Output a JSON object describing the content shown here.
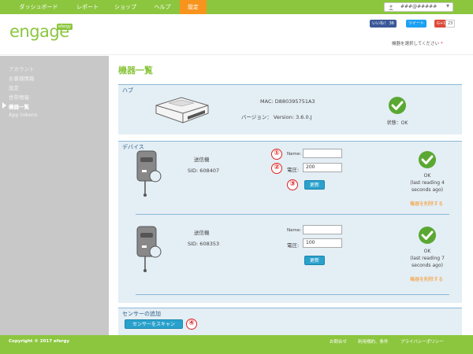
{
  "nav": {
    "items": [
      {
        "label": "ダッシュボード"
      },
      {
        "label": "レポート"
      },
      {
        "label": "ショップ"
      },
      {
        "label": "ヘルプ"
      },
      {
        "label": "設定"
      }
    ],
    "user_name": "###@#####"
  },
  "header": {
    "logo_text": "engage",
    "logo_badge": "efergy",
    "fb_label": "いいね！ 36",
    "tw_label": "ツイート",
    "gp_label": "G+1",
    "social_count": "23",
    "device_select_hint": "機器を選択してください",
    "required_mark": "*"
  },
  "sidebar": {
    "items": [
      {
        "label": "アカウント"
      },
      {
        "label": "お客様情報"
      },
      {
        "label": "設定"
      },
      {
        "label": "世帯情報"
      },
      {
        "label": "機器一覧"
      },
      {
        "label": "App tokens"
      }
    ]
  },
  "main": {
    "page_title": "機器一覧",
    "hub": {
      "title": "ハブ",
      "mac": "MAC: D880395751A3",
      "version": "バージョン： Version: 3.6.0.J",
      "status": "状態：OK"
    },
    "devices_title": "デバイス",
    "devices": [
      {
        "type": "送信機",
        "sid": "SID: 608407",
        "name_label": "Name:",
        "name_value": "",
        "voltage_label": "電圧:",
        "voltage_value": "200",
        "update_label": "更新",
        "status_ok": "OK",
        "status_detail_1": "(last reading 4",
        "status_detail_2": "seconds ago)",
        "remove_label": "機器を削除する"
      },
      {
        "type": "送信機",
        "sid": "SID: 608353",
        "name_label": "Name:",
        "name_value": "",
        "voltage_label": "電圧:",
        "voltage_value": "100",
        "update_label": "更新",
        "status_ok": "OK",
        "status_detail_1": "(last reading 7",
        "status_detail_2": "seconds ago)",
        "remove_label": "機器を削除する"
      }
    ],
    "add_sensor_title": "センサーの追加",
    "scan_button": "センサーをスキャン",
    "markers": [
      "①",
      "②",
      "③",
      "④"
    ]
  },
  "footer": {
    "copyright": "Copyright © 2017 efergy",
    "links": [
      {
        "label": "お問合せ"
      },
      {
        "label": "利用規約、条件"
      },
      {
        "label": "プライバシーポリシー"
      }
    ]
  },
  "colors": {
    "brand_green": "#8cc63f",
    "active_orange": "#f7941d",
    "button_blue": "#2aa1cc",
    "panel_bg": "#e4eef5",
    "check_green": "#5aa832"
  }
}
